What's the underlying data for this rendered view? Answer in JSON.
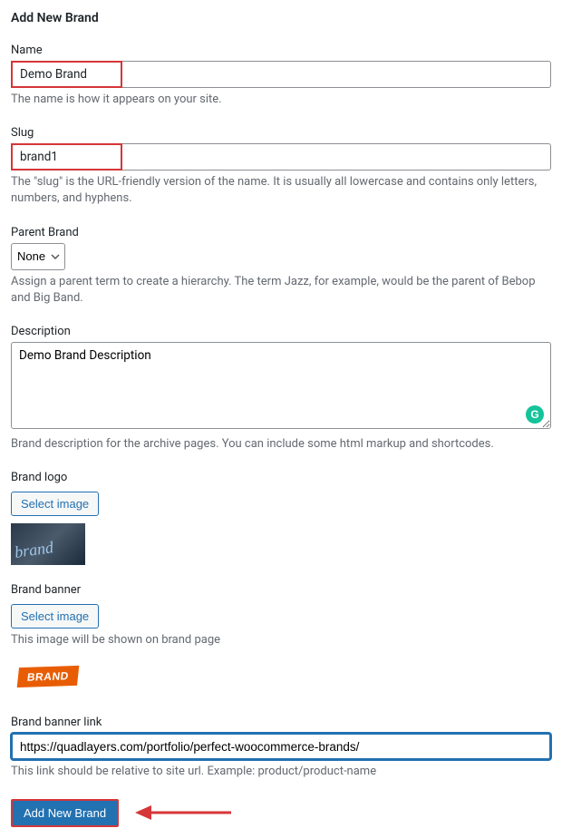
{
  "heading": "Add New Brand",
  "name": {
    "label": "Name",
    "value": "Demo Brand",
    "help": "The name is how it appears on your site."
  },
  "slug": {
    "label": "Slug",
    "value": "brand1",
    "help": "The \"slug\" is the URL-friendly version of the name. It is usually all lowercase and contains only letters, numbers, and hyphens."
  },
  "parent": {
    "label": "Parent Brand",
    "selected": "None",
    "help": "Assign a parent term to create a hierarchy. The term Jazz, for example, would be the parent of Bebop and Big Band."
  },
  "description": {
    "label": "Description",
    "value": "Demo Brand Description",
    "help": "Brand description for the archive pages. You can include some html markup and shortcodes."
  },
  "brand_logo": {
    "label": "Brand logo",
    "button": "Select image"
  },
  "brand_banner": {
    "label": "Brand banner",
    "button": "Select image",
    "help": "This image will be shown on brand page"
  },
  "banner_link": {
    "label": "Brand banner link",
    "value": "https://quadlayers.com/portfolio/perfect-woocommerce-brands/",
    "help": "This link should be relative to site url. Example: product/product-name"
  },
  "submit": {
    "label": "Add New Brand"
  },
  "colors": {
    "accent": "#2271b1",
    "highlight": "#d63638",
    "muted": "#646970"
  }
}
